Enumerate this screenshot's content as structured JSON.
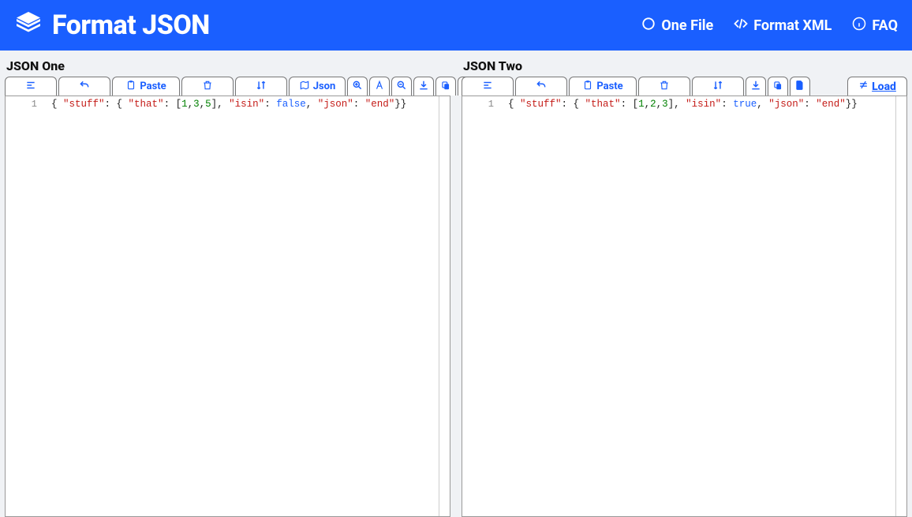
{
  "header": {
    "logo_text": "Format JSON",
    "nav": {
      "one_file": "One File",
      "format_xml": "Format XML",
      "faq": "FAQ"
    }
  },
  "pane_left": {
    "title": "JSON One",
    "toolbar": {
      "paste_label": "Paste",
      "json_label": "Json"
    },
    "line_number": "1",
    "code_tokens": [
      {
        "t": "p",
        "v": "{ "
      },
      {
        "t": "k",
        "v": "\"stuff\""
      },
      {
        "t": "p",
        "v": ": { "
      },
      {
        "t": "k",
        "v": "\"that\""
      },
      {
        "t": "p",
        "v": ": ["
      },
      {
        "t": "g",
        "v": "1"
      },
      {
        "t": "p",
        "v": ","
      },
      {
        "t": "g",
        "v": "3"
      },
      {
        "t": "p",
        "v": ","
      },
      {
        "t": "g",
        "v": "5"
      },
      {
        "t": "p",
        "v": "], "
      },
      {
        "t": "k",
        "v": "\"isin\""
      },
      {
        "t": "p",
        "v": ": "
      },
      {
        "t": "b",
        "v": "false"
      },
      {
        "t": "p",
        "v": ", "
      },
      {
        "t": "k",
        "v": "\"json\""
      },
      {
        "t": "p",
        "v": ": "
      },
      {
        "t": "k",
        "v": "\"end\""
      },
      {
        "t": "p",
        "v": "}}"
      }
    ]
  },
  "pane_right": {
    "title": "JSON Two",
    "toolbar": {
      "paste_label": "Paste",
      "load_label": "Load"
    },
    "line_number": "1",
    "code_tokens": [
      {
        "t": "p",
        "v": "{ "
      },
      {
        "t": "k",
        "v": "\"stuff\""
      },
      {
        "t": "p",
        "v": ": { "
      },
      {
        "t": "k",
        "v": "\"that\""
      },
      {
        "t": "p",
        "v": ": ["
      },
      {
        "t": "g",
        "v": "1"
      },
      {
        "t": "p",
        "v": ","
      },
      {
        "t": "g",
        "v": "2"
      },
      {
        "t": "p",
        "v": ","
      },
      {
        "t": "g",
        "v": "3"
      },
      {
        "t": "p",
        "v": "], "
      },
      {
        "t": "k",
        "v": "\"isin\""
      },
      {
        "t": "p",
        "v": ": "
      },
      {
        "t": "b",
        "v": "true"
      },
      {
        "t": "p",
        "v": ", "
      },
      {
        "t": "k",
        "v": "\"json\""
      },
      {
        "t": "p",
        "v": ": "
      },
      {
        "t": "k",
        "v": "\"end\""
      },
      {
        "t": "p",
        "v": "}}"
      }
    ]
  }
}
